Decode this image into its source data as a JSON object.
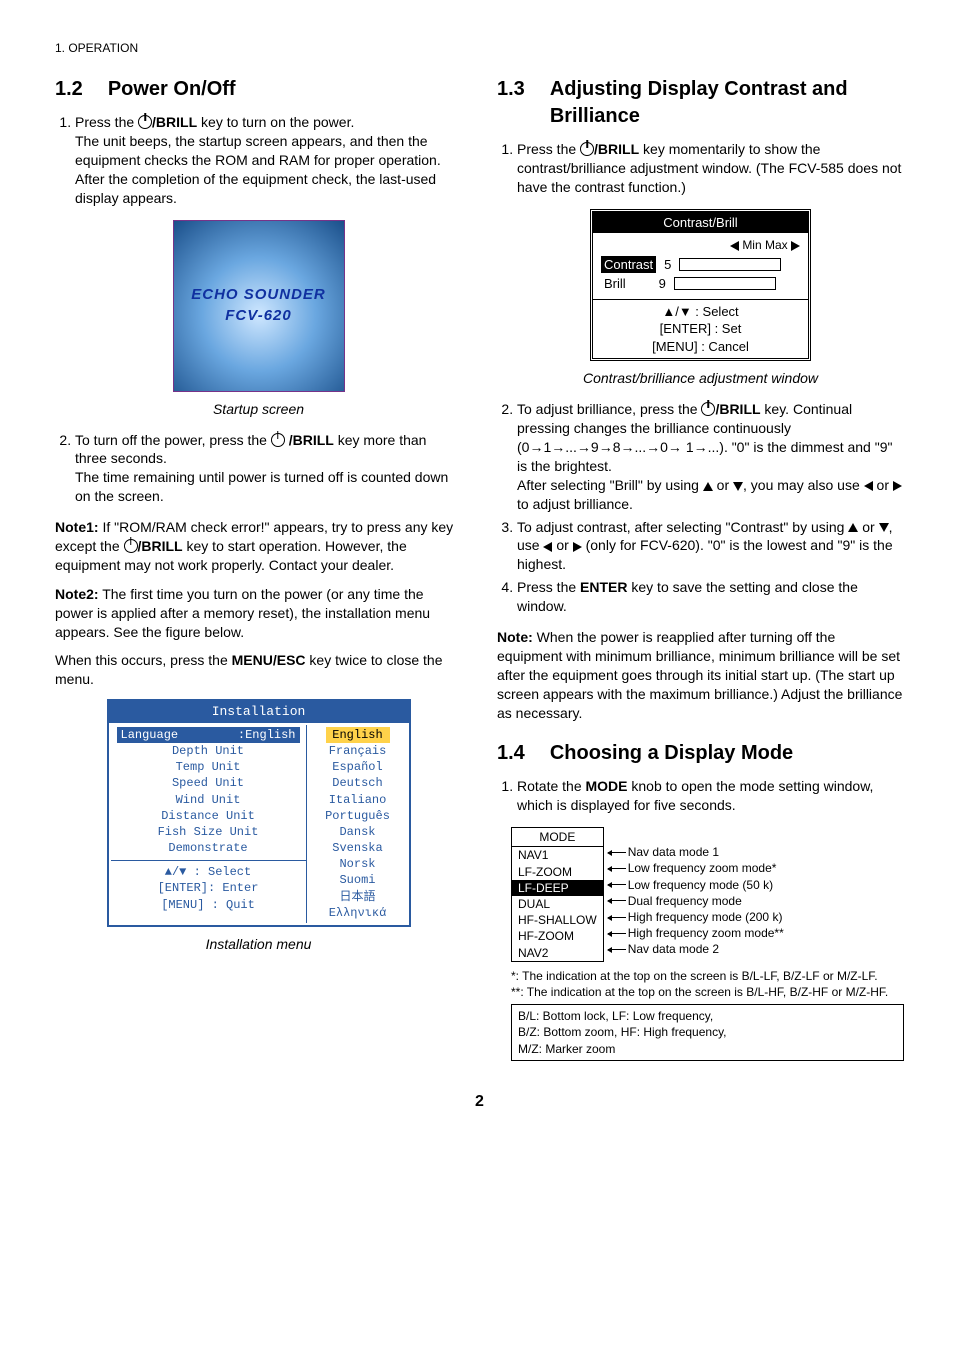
{
  "header": "1. OPERATION",
  "s12": {
    "num": "1.2",
    "title": "Power On/Off",
    "step1a": "Press the ",
    "step1b": "/BRILL",
    "step1c": " key to turn on the power.",
    "step1para": "The unit beeps, the startup screen appears, and then the equipment checks the ROM and RAM for proper operation. After the completion of the equipment check, the last-used display appears.",
    "startup1": "ECHO SOUNDER",
    "startup2": "FCV-620",
    "startupCap": "Startup screen",
    "step2a": "To turn off the power, press the ",
    "step2b": " /BRILL",
    "step2c": " key more than three seconds.",
    "step2para": "The time remaining until power is turned off is counted down on the screen.",
    "note1a": "Note1:",
    "note1b": " If \"ROM/RAM check error!\" appears, try to press any key except the ",
    "note1c": "/BRILL",
    "note1d": " key to start operation. However, the equipment may not work properly. Contact your dealer.",
    "note2a": "Note2:",
    "note2b": " The first time you turn on the power (or any time the power is applied after a memory reset), the installation menu appears. See the figure below.",
    "note2c": "When this occurs, press the ",
    "note2d": "MENU/ESC",
    "note2e": " key twice to close the menu.",
    "install": {
      "title": "Installation",
      "langLabel": "Language",
      "langVal": ":English",
      "left": [
        "Depth    Unit",
        "Temp     Unit",
        "Speed    Unit",
        "Wind     Unit",
        "Distance Unit",
        "Fish Size Unit",
        "Demonstrate"
      ],
      "foot": [
        "▲/▼  : Select",
        "[ENTER]: Enter",
        "[MENU] : Quit"
      ],
      "right": [
        "English",
        "Français",
        "Español",
        "Deutsch",
        "Italiano",
        "Português",
        "Dansk",
        "Svenska",
        "Norsk",
        "Suomi",
        "日本語",
        "Ελληνικά"
      ]
    },
    "installCap": "Installation menu"
  },
  "s13": {
    "num": "1.3",
    "title": "Adjusting Display Contrast and Brilliance",
    "step1a": "Press the ",
    "step1b": "/BRILL",
    "step1c": " key momentarily to show the contrast/brilliance adjustment window. (The FCV-585 does not have the contrast function.)",
    "cb": {
      "title": "Contrast/Brill",
      "minmax": "Min  Max",
      "rowC": "Contrast",
      "valC": "5",
      "rowB": "Brill",
      "valB": "9",
      "f1": "▲/▼     : Select",
      "f2": "[ENTER] : Set",
      "f3": "[MENU]  : Cancel"
    },
    "cbCap": "Contrast/brilliance adjustment window",
    "step2a": "To adjust brilliance, press the ",
    "step2b": "/BRILL",
    "step2c": " key. Continual pressing changes the brilliance continuously (0→1→...→9→8→...→0→ 1→...). \"0\" is the dimmest and \"9\" is the brightest.",
    "step2p2a": "After selecting \"Brill\" by using ",
    "step2p2b": ", you may also use ",
    "step2p2c": " to adjust brilliance.",
    "step3a": "To adjust contrast, after selecting \"Contrast\" by using ",
    "step3b": ", use ",
    "step3c": " (only for FCV-620). \"0\" is the lowest and \"9\" is the highest.",
    "step4a": "Press the ",
    "step4b": "ENTER",
    "step4c": " key to save the setting and close the window.",
    "notea": "Note:",
    "noteb": " When the power is reapplied after turning off the equipment with minimum brilliance, minimum brilliance will be set after the equipment goes through its initial start up. (The start up screen appears with the maximum brilliance.) Adjust the brilliance as necessary."
  },
  "s14": {
    "num": "1.4",
    "title": "Choosing a Display Mode",
    "step1a": "Rotate the ",
    "step1b": "MODE",
    "step1c": " knob to open the mode setting window, which is displayed for five seconds.",
    "mode": {
      "head": "MODE",
      "items": [
        "NAV1",
        "LF-ZOOM",
        "LF-DEEP",
        "DUAL",
        "HF-SHALLOW",
        "HF-ZOOM",
        "NAV2"
      ],
      "selIndex": 2,
      "desc": [
        "Nav data mode 1",
        "Low frequency zoom mode*",
        "Low frequency mode (50 k)",
        "Dual frequency mode",
        "High frequency mode (200 k)",
        "High frequency zoom mode**",
        "Nav data mode 2"
      ]
    },
    "foot1": "*:  The indication at the top on the screen is B/L-LF, B/Z-LF or M/Z-LF.",
    "foot2": "**: The indication at the top on the screen is B/L-HF, B/Z-HF or M/Z-HF.",
    "legend": "B/L: Bottom lock, LF: Low frequency,\nB/Z: Bottom zoom, HF: High frequency,\nM/Z: Marker zoom"
  },
  "pageNum": "2"
}
